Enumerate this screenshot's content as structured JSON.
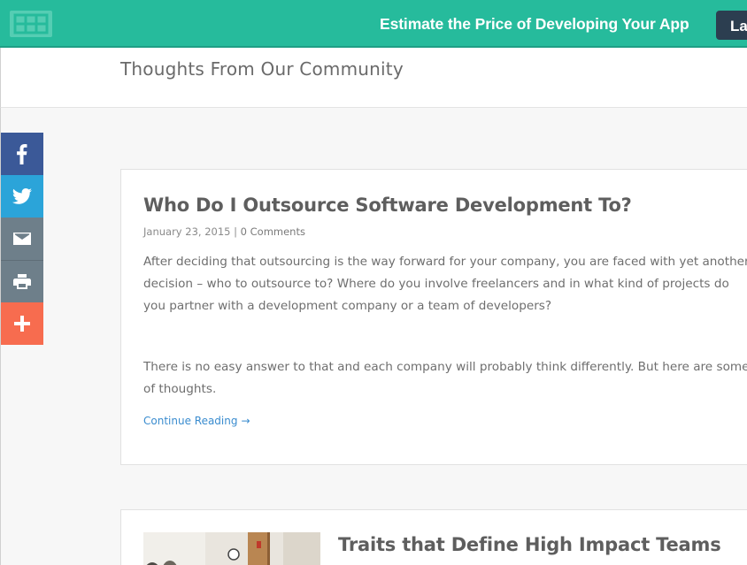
{
  "banner": {
    "cta_text": "Estimate the Price of Developing Your App",
    "button_label": "La"
  },
  "header": {
    "page_title": "Thoughts From Our Community"
  },
  "share_bar": {
    "items": [
      {
        "name": "facebook",
        "icon": "facebook-icon",
        "color": "#3b5998"
      },
      {
        "name": "twitter",
        "icon": "twitter-icon",
        "color": "#2ba4d9"
      },
      {
        "name": "email",
        "icon": "mail-icon",
        "color": "#6e7f8a"
      },
      {
        "name": "print",
        "icon": "printer-icon",
        "color": "#6e7f8a"
      },
      {
        "name": "more",
        "icon": "plus-icon",
        "color": "#f76c4f"
      }
    ]
  },
  "posts": [
    {
      "title": "Who Do I Outsource Software Development To?",
      "date": "January 23, 2015",
      "separator": "|",
      "comments": "0 Comments",
      "paragraph1": "After deciding that outsourcing is the way forward for your company, you are faced with yet another decision – who to outsource to? Where do you involve freelancers and in what kind of projects do you partner with a development company or a team of developers?",
      "paragraph2": "There is no easy answer to that and each company will probably think differently. But here are some of thoughts.",
      "continue_label": "Continue Reading",
      "continue_arrow": "→"
    },
    {
      "title": "Traits that Define High Impact Teams"
    }
  ],
  "colors": {
    "brand_teal": "#26bb9c",
    "dark_button": "#2c3e50",
    "link_blue": "#3a8ccf"
  }
}
